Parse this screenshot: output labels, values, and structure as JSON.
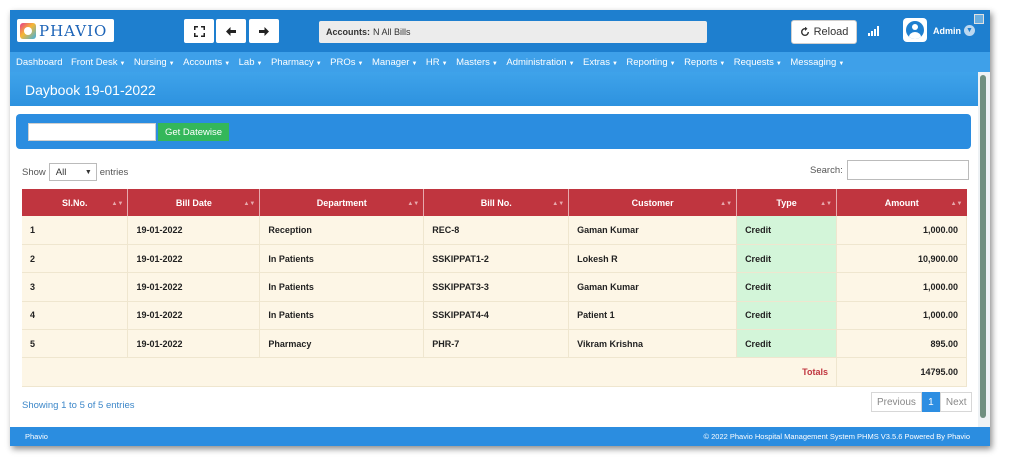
{
  "header": {
    "logo_text": "PHAVIO",
    "accounts_label": "Accounts:",
    "accounts_value": "N All Bills",
    "reload_label": "Reload",
    "user": "Admin"
  },
  "nav": [
    {
      "label": "Dashboard",
      "dropdown": false
    },
    {
      "label": "Front Desk",
      "dropdown": true
    },
    {
      "label": "Nursing",
      "dropdown": true
    },
    {
      "label": "Accounts",
      "dropdown": true
    },
    {
      "label": "Lab",
      "dropdown": true
    },
    {
      "label": "Pharmacy",
      "dropdown": true
    },
    {
      "label": "PROs",
      "dropdown": true
    },
    {
      "label": "Manager",
      "dropdown": true
    },
    {
      "label": "HR",
      "dropdown": true
    },
    {
      "label": "Masters",
      "dropdown": true
    },
    {
      "label": "Administration",
      "dropdown": true
    },
    {
      "label": "Extras",
      "dropdown": true
    },
    {
      "label": "Reporting",
      "dropdown": true
    },
    {
      "label": "Reports",
      "dropdown": true
    },
    {
      "label": "Requests",
      "dropdown": true
    },
    {
      "label": "Messaging",
      "dropdown": true
    }
  ],
  "page": {
    "title": "Daybook 19-01-2022",
    "date_value": "",
    "get_datewise_label": "Get Datewise"
  },
  "table_controls": {
    "show_label": "Show",
    "show_value": "All",
    "entries_label": "entries",
    "search_label": "Search:"
  },
  "table": {
    "columns": [
      "Sl.No.",
      "Bill Date",
      "Department",
      "Bill No.",
      "Customer",
      "Type",
      "Amount"
    ],
    "rows": [
      {
        "sl": "1",
        "date": "19-01-2022",
        "dept": "Reception",
        "bill": "REC-8",
        "customer": "Gaman Kumar",
        "type": "Credit",
        "amount": "1,000.00"
      },
      {
        "sl": "2",
        "date": "19-01-2022",
        "dept": "In Patients",
        "bill": "SSKIPPAT1-2",
        "customer": "Lokesh R",
        "type": "Credit",
        "amount": "10,900.00"
      },
      {
        "sl": "3",
        "date": "19-01-2022",
        "dept": "In Patients",
        "bill": "SSKIPPAT3-3",
        "customer": "Gaman Kumar",
        "type": "Credit",
        "amount": "1,000.00"
      },
      {
        "sl": "4",
        "date": "19-01-2022",
        "dept": "In Patients",
        "bill": "SSKIPPAT4-4",
        "customer": "Patient 1",
        "type": "Credit",
        "amount": "1,000.00"
      },
      {
        "sl": "5",
        "date": "19-01-2022",
        "dept": "Pharmacy",
        "bill": "PHR-7",
        "customer": "Vikram Krishna",
        "type": "Credit",
        "amount": "895.00"
      }
    ],
    "totals_label": "Totals",
    "totals_value": "14795.00"
  },
  "pagination": {
    "info": "Showing 1 to 5 of 5 entries",
    "previous": "Previous",
    "page": "1",
    "next": "Next"
  },
  "footer": {
    "left": "Phavio",
    "right": "© 2022 Phavio Hospital Management System PHMS V3.5.6 Powered By Phavio"
  },
  "colors": {
    "header_blue": "#1e7fcf",
    "nav_blue": "#3ea0e9",
    "table_header": "#c0353f",
    "row_bg": "#fdf6e6",
    "type_bg": "#d3f5d9",
    "button_green": "#34b75a"
  },
  "icons": {
    "fullscreen": "expand-icon",
    "back": "arrow-left-icon",
    "forward": "arrow-right-icon",
    "reload": "refresh-icon",
    "signal": "signal-icon",
    "user": "user-circle-icon",
    "user_menu": "chevron-down-icon"
  }
}
